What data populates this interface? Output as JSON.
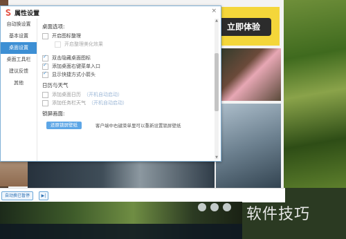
{
  "background": {
    "cta_label": "立即体验",
    "status_pill": "自动换已暂停",
    "status_next": "▶|",
    "watermark": "软件技巧"
  },
  "dialog": {
    "title": "属性设置",
    "close": "×",
    "sidebar": [
      {
        "label": "自动换设置",
        "active": false
      },
      {
        "label": "基本设置",
        "active": false
      },
      {
        "label": "桌面设置",
        "active": true
      },
      {
        "label": "桌面工具栏",
        "active": false
      },
      {
        "label": "建议反馈",
        "active": false
      },
      {
        "label": "其他",
        "active": false
      }
    ],
    "desktop_options": {
      "title": "桌面选项:",
      "enable_icon_organize": "开启图标整理",
      "enable_organize_effect": "开启整理美化效果",
      "double_click_hide": "双击隐藏桌面图标",
      "add_context_menu": "添加桌面右键菜单入口",
      "show_shortcut_arrow": "显示快捷方式小箭头"
    },
    "calendar_weather": {
      "title": "日历与天气",
      "add_calendar": "添加桌面日历",
      "add_calendar_hint": "（开机自动启动）",
      "add_taskbar_weather": "添加任务栏天气",
      "add_taskbar_weather_hint": "（开机自动启动）"
    },
    "lock_screen": {
      "title": "锁屏画面:",
      "reset_button": "还原锁屏壁纸",
      "note": "客户端中右键菜单里可以重新设置锁屏壁纸"
    }
  },
  "colors": {
    "accent": "#3d8fd4",
    "button": "#5da6e6",
    "cta_bg": "#f4d63a"
  }
}
